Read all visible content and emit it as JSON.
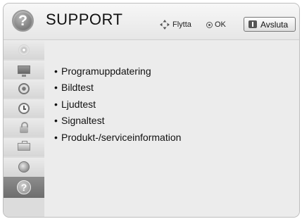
{
  "header": {
    "icon_symbol": "?",
    "title": "SUPPORT",
    "hint_move_label": "Flytta",
    "hint_ok_label": "OK",
    "exit_label": "Avsluta"
  },
  "sidebar": {
    "items": [
      {
        "icon": "disc-icon"
      },
      {
        "icon": "screen-icon"
      },
      {
        "icon": "speaker-icon"
      },
      {
        "icon": "clock-icon"
      },
      {
        "icon": "lock-icon"
      },
      {
        "icon": "toolbox-icon"
      },
      {
        "icon": "globe-icon"
      },
      {
        "icon": "help-icon",
        "symbol": "?",
        "active": true
      }
    ]
  },
  "menu": {
    "bullet": "•",
    "items": [
      "Programuppdatering",
      "Bildtest",
      "Ljudtest",
      "Signaltest",
      "Produkt-/serviceinformation"
    ]
  }
}
